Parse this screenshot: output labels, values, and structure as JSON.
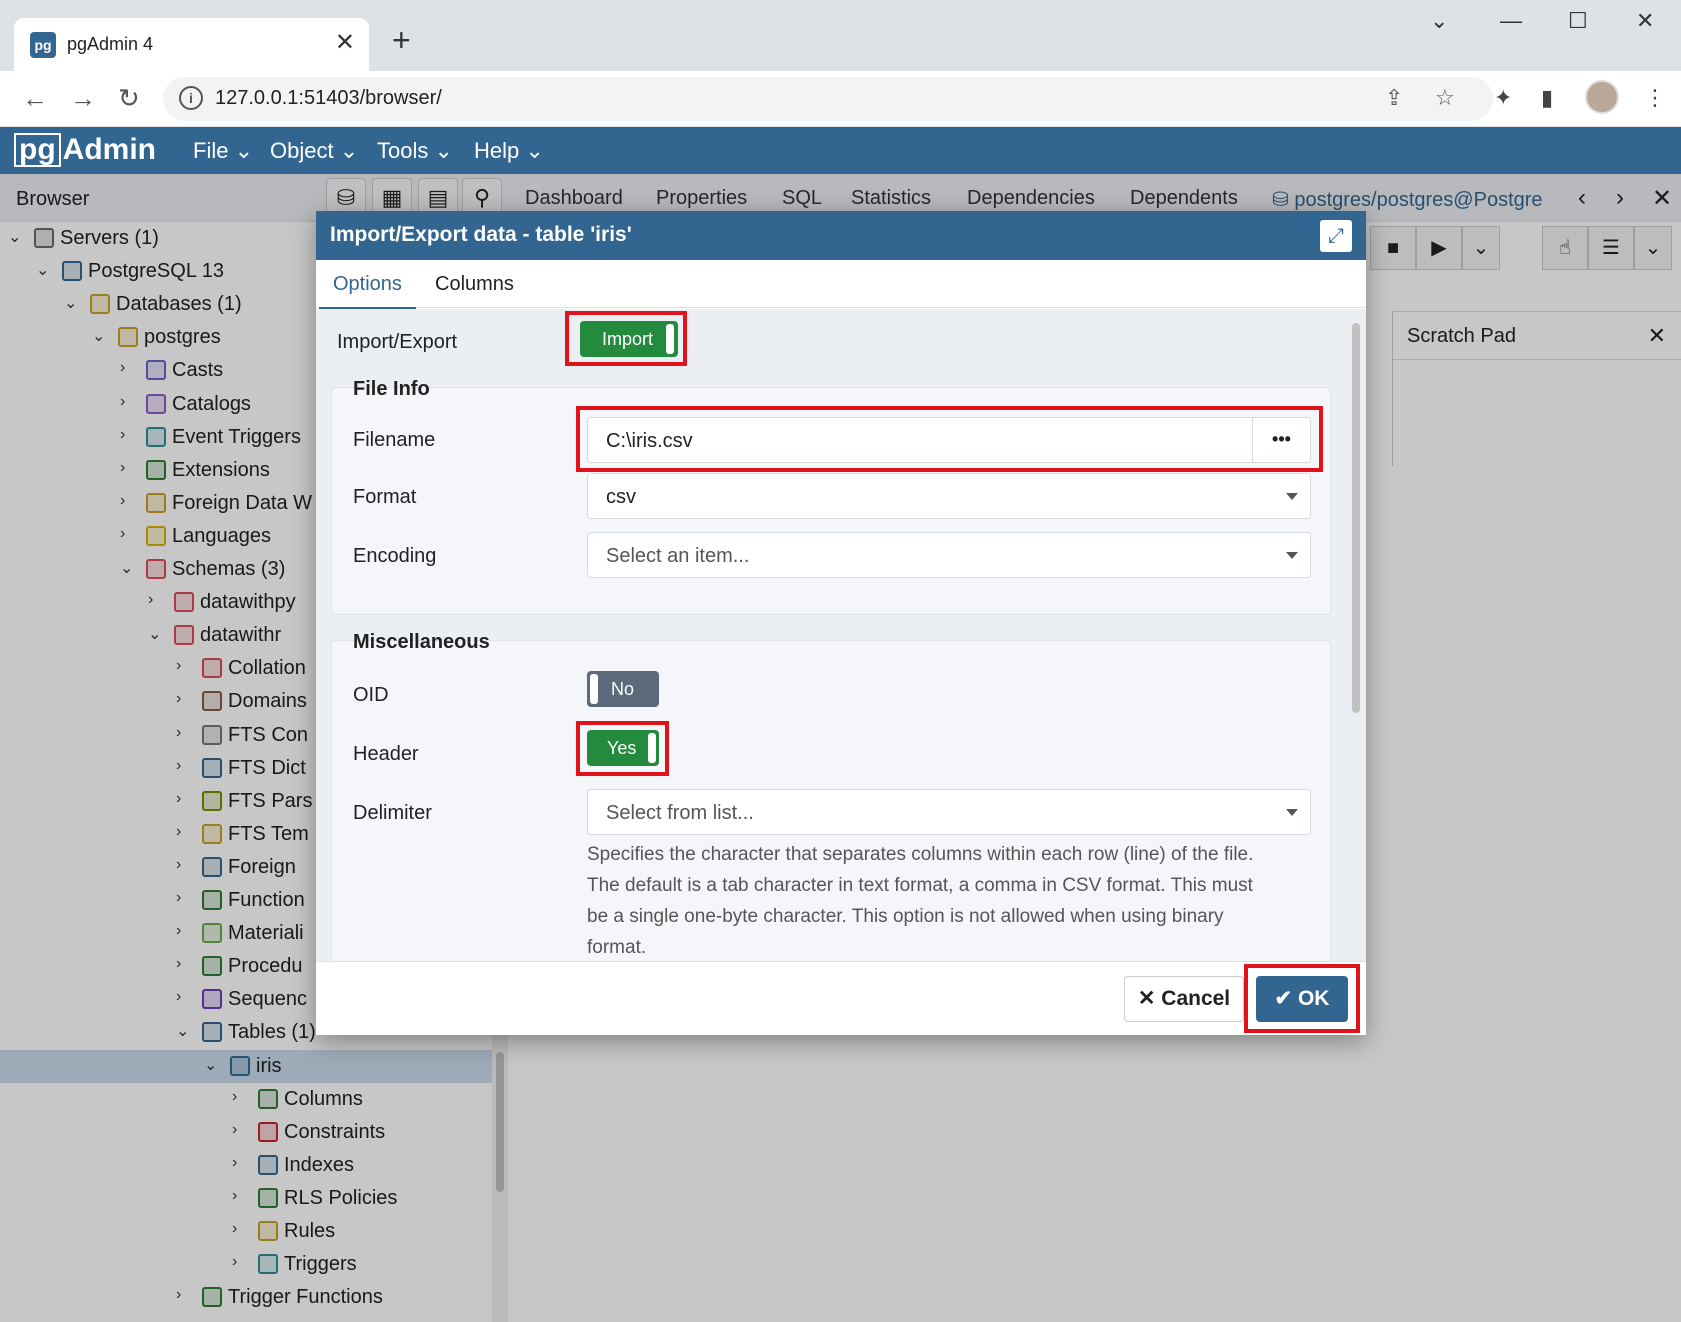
{
  "browser": {
    "tab_title": "pgAdmin 4",
    "tab_favicon": "pg",
    "url": "127.0.0.1:51403/browser/"
  },
  "app": {
    "logo_pg": "pg",
    "logo_text": "Admin",
    "menus": [
      "File",
      "Object",
      "Tools",
      "Help"
    ]
  },
  "browser_panel": {
    "title": "Browser",
    "tree": [
      {
        "label": "Servers (1)",
        "depth": 0,
        "state": "open",
        "icon": "servers-icon",
        "color": "#6b6b6b"
      },
      {
        "label": "PostgreSQL 13",
        "depth": 1,
        "state": "open",
        "icon": "postgresql-elephant-icon",
        "color": "#336791"
      },
      {
        "label": "Databases (1)",
        "depth": 2,
        "state": "open",
        "icon": "databases-icon",
        "color": "#c9a227"
      },
      {
        "label": "postgres",
        "depth": 3,
        "state": "open",
        "icon": "database-icon",
        "color": "#c9a227"
      },
      {
        "label": "Casts",
        "depth": 4,
        "state": "closed",
        "icon": "casts-icon",
        "color": "#6c63c9"
      },
      {
        "label": "Catalogs",
        "depth": 4,
        "state": "closed",
        "icon": "catalogs-icon",
        "color": "#8b5cc9"
      },
      {
        "label": "Event Triggers",
        "depth": 4,
        "state": "closed",
        "icon": "event-triggers-icon",
        "color": "#2e8b9a"
      },
      {
        "label": "Extensions",
        "depth": 4,
        "state": "closed",
        "icon": "extensions-icon",
        "color": "#2e7d32"
      },
      {
        "label": "Foreign Data W",
        "depth": 4,
        "state": "closed",
        "icon": "foreign-data-wrapper-icon",
        "color": "#c9a227"
      },
      {
        "label": "Languages",
        "depth": 4,
        "state": "closed",
        "icon": "languages-icon",
        "color": "#d4b400"
      },
      {
        "label": "Schemas (3)",
        "depth": 4,
        "state": "open",
        "icon": "schemas-icon",
        "color": "#d94b5a"
      },
      {
        "label": "datawithpy",
        "depth": 5,
        "state": "closed",
        "icon": "schema-icon",
        "color": "#d94b5a"
      },
      {
        "label": "datawithr",
        "depth": 5,
        "state": "open",
        "icon": "schema-icon",
        "color": "#d94b5a"
      },
      {
        "label": "Collation",
        "depth": 6,
        "state": "closed",
        "icon": "collations-icon",
        "color": "#d94b5a"
      },
      {
        "label": "Domains",
        "depth": 6,
        "state": "closed",
        "icon": "domains-icon",
        "color": "#8a5a44"
      },
      {
        "label": "FTS Con",
        "depth": 6,
        "state": "closed",
        "icon": "fts-configurations-icon",
        "color": "#777777"
      },
      {
        "label": "FTS Dict",
        "depth": 6,
        "state": "closed",
        "icon": "fts-dictionaries-icon",
        "color": "#336791"
      },
      {
        "label": "FTS Pars",
        "depth": 6,
        "state": "closed",
        "icon": "fts-parsers-icon",
        "color": "#7a8b00"
      },
      {
        "label": "FTS Tem",
        "depth": 6,
        "state": "closed",
        "icon": "fts-templates-icon",
        "color": "#c9a227"
      },
      {
        "label": "Foreign",
        "depth": 6,
        "state": "closed",
        "icon": "foreign-tables-icon",
        "color": "#336791"
      },
      {
        "label": "Function",
        "depth": 6,
        "state": "closed",
        "icon": "functions-icon",
        "color": "#2e7d32"
      },
      {
        "label": "Materiali",
        "depth": 6,
        "state": "closed",
        "icon": "materialized-views-icon",
        "color": "#6aa84f"
      },
      {
        "label": "Procedu",
        "depth": 6,
        "state": "closed",
        "icon": "procedures-icon",
        "color": "#2e7d32"
      },
      {
        "label": "Sequenc",
        "depth": 6,
        "state": "closed",
        "icon": "sequences-icon",
        "color": "#6c3cb4"
      },
      {
        "label": "Tables (1)",
        "depth": 6,
        "state": "open",
        "icon": "tables-icon",
        "color": "#336791"
      },
      {
        "label": "iris",
        "depth": 7,
        "state": "open",
        "icon": "table-icon",
        "color": "#336791",
        "selected": true
      },
      {
        "label": "Columns",
        "depth": 8,
        "state": "closed",
        "icon": "columns-icon",
        "color": "#2e7d32"
      },
      {
        "label": "Constraints",
        "depth": 8,
        "state": "closed",
        "icon": "constraints-icon",
        "color": "#c62828"
      },
      {
        "label": "Indexes",
        "depth": 8,
        "state": "closed",
        "icon": "indexes-icon",
        "color": "#336791"
      },
      {
        "label": "RLS Policies",
        "depth": 8,
        "state": "closed",
        "icon": "rls-policies-icon",
        "color": "#2e7d32"
      },
      {
        "label": "Rules",
        "depth": 8,
        "state": "closed",
        "icon": "rules-icon",
        "color": "#c9a227"
      },
      {
        "label": "Triggers",
        "depth": 8,
        "state": "closed",
        "icon": "triggers-icon",
        "color": "#2e8b9a"
      },
      {
        "label": "Trigger Functions",
        "depth": 6,
        "state": "closed",
        "icon": "trigger-functions-icon",
        "color": "#2e7d32"
      }
    ]
  },
  "main_tabs": [
    "Dashboard",
    "Properties",
    "SQL",
    "Statistics",
    "Dependencies",
    "Dependents"
  ],
  "query_tab": "postgres/postgres@Postgre",
  "scratch_pad": {
    "title": "Scratch Pad"
  },
  "dialog": {
    "title": "Import/Export data - table 'iris'",
    "tabs": [
      "Options",
      "Columns"
    ],
    "active_tab": "Options",
    "import_export": {
      "label": "Import/Export",
      "value": "Import",
      "on": true
    },
    "file_info": {
      "legend": "File Info",
      "filename_label": "Filename",
      "filename_value": "C:\\iris.csv",
      "browse_button": "•••",
      "format_label": "Format",
      "format_value": "csv",
      "encoding_label": "Encoding",
      "encoding_placeholder": "Select an item..."
    },
    "misc": {
      "legend": "Miscellaneous",
      "oid_label": "OID",
      "oid_value": "No",
      "header_label": "Header",
      "header_value": "Yes",
      "delimiter_label": "Delimiter",
      "delimiter_placeholder": "Select from list...",
      "delimiter_help": "Specifies the character that separates columns within each row (line) of the file. The default is a tab character in text format, a comma in CSV format. This must be a single one-byte character. This option is not allowed when using binary format."
    },
    "cancel_label": "Cancel",
    "ok_label": "OK"
  },
  "colors": {
    "pgadmin_blue": "#326690",
    "toggle_on": "#248a3d",
    "toggle_off": "#5b6b7b",
    "highlight_red": "#e0121a"
  }
}
